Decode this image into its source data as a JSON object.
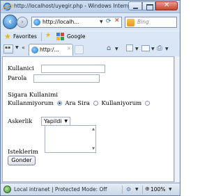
{
  "window": {
    "title": "http://localhost/uyegir.php - Windows Internet Exp..."
  },
  "address_bar": {
    "url": "http://localh...",
    "search_placeholder": "Bing"
  },
  "favorites_bar": {
    "favorites_label": "Favorites",
    "links": [
      {
        "label": "Google"
      }
    ]
  },
  "tabs": [
    {
      "title": "http:/..."
    }
  ],
  "form": {
    "kullanici_label": "Kullanici",
    "kullanici_value": "",
    "parola_label": "Parola",
    "parola_value": "",
    "sigara_heading": "Sigara Kullanimi",
    "sigara_options": [
      {
        "label": "Kullanmiyorum",
        "selected": true
      },
      {
        "label": "Ara Sira",
        "selected": false
      },
      {
        "label": "Kullaniyorum",
        "selected": false
      }
    ],
    "askerlik_label": "Askerlik",
    "askerlik_selected": "Yapildi",
    "istekler_label": "Isteklerim",
    "istekler_value": "",
    "submit_label": "Gonder"
  },
  "status_bar": {
    "zone_text": "Local intranet | Protected Mode: Off",
    "zoom": "100%"
  },
  "icons": {
    "browser": "ie-icon",
    "back": "back-arrow-icon",
    "forward": "forward-arrow-icon",
    "refresh": "refresh-icon",
    "stop": "stop-icon",
    "search_provider": "bing-icon",
    "favorites": "star-icon",
    "home": "home-icon",
    "print": "print-icon",
    "zone": "globe-icon"
  },
  "colors": {
    "chrome": "#c9d9ee",
    "close_button": "#c8432a"
  }
}
